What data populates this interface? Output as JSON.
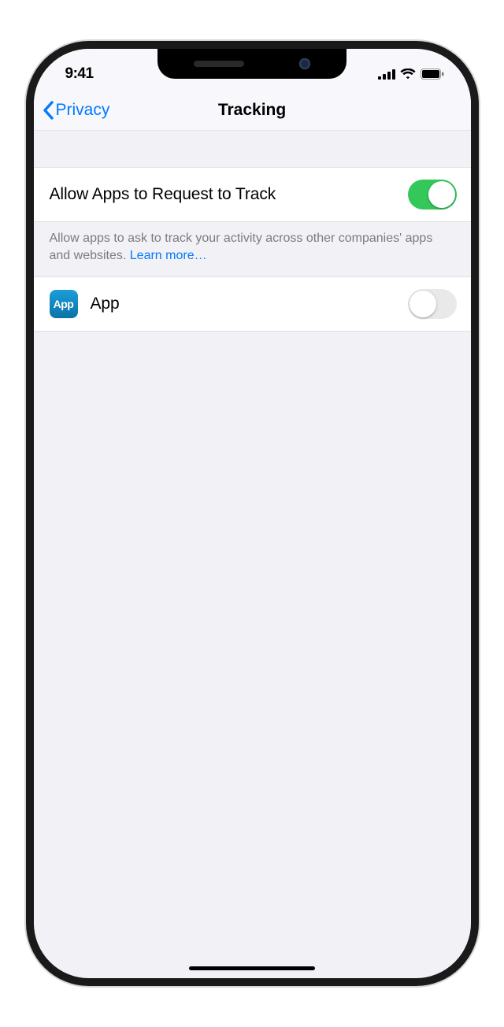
{
  "status": {
    "time": "9:41"
  },
  "nav": {
    "back": "Privacy",
    "title": "Tracking"
  },
  "allow_row": {
    "label": "Allow Apps to Request to Track",
    "switch_on": true
  },
  "allow_footer": {
    "text": "Allow apps to ask to track your activity across other companies' apps and websites. ",
    "link": "Learn more…"
  },
  "apps": [
    {
      "name": "App",
      "icon_text": "App",
      "switch_on": false
    }
  ]
}
